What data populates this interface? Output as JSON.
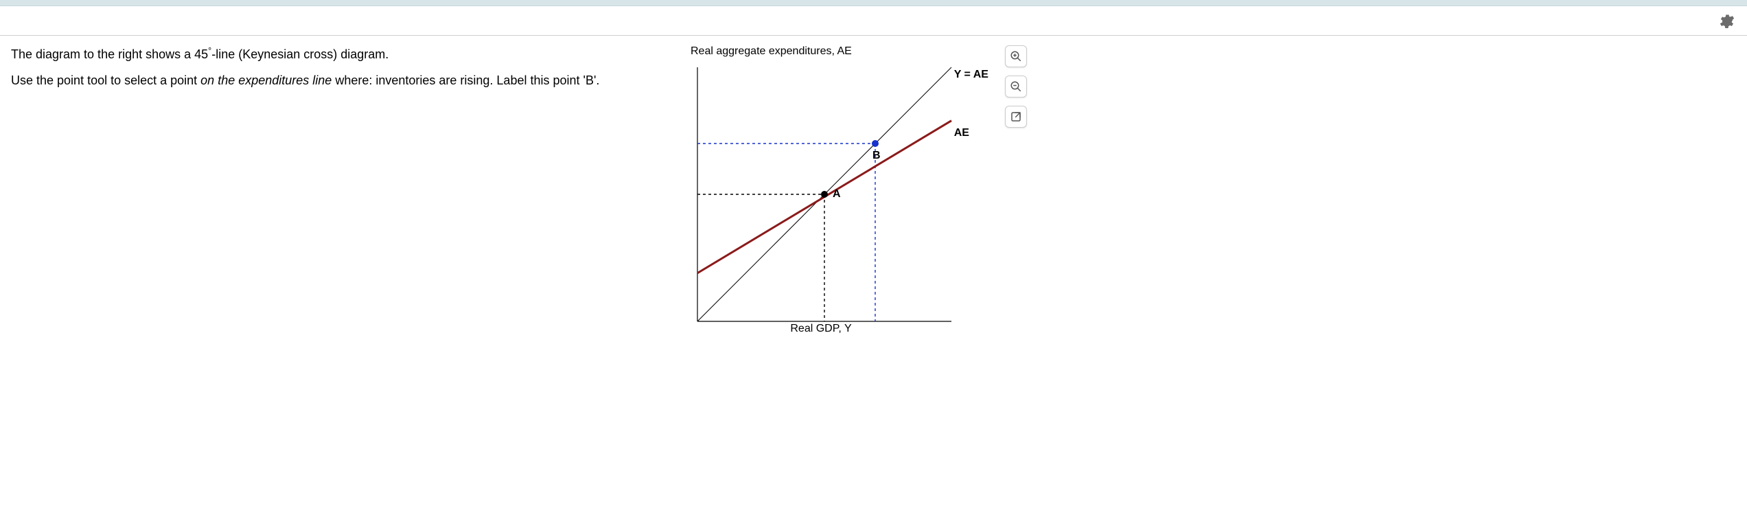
{
  "question": {
    "intro_html": "The diagram to the right shows a 45<span class='sup'>°</span>-line (Keynesian cross) diagram.",
    "task_html": "Use the point tool to select a point <span class='italic'>on the expenditures line</span> where: inventories are rising. Label this point 'B'."
  },
  "chart_data": {
    "type": "line",
    "title": "Real aggregate expenditures, AE",
    "xlabel": "Real GDP, Y",
    "ylabel": "",
    "xlim": [
      0,
      10
    ],
    "ylim": [
      0,
      10
    ],
    "series": [
      {
        "name": "Y = AE",
        "x": [
          0,
          10
        ],
        "y": [
          0,
          10
        ],
        "color": "#000000",
        "width": 1
      },
      {
        "name": "AE",
        "x": [
          0,
          10
        ],
        "y": [
          1.9,
          7.9
        ],
        "color": "#8b1a1a",
        "width": 3
      }
    ],
    "points": [
      {
        "name": "A",
        "x": 5.0,
        "y": 5.0,
        "color": "#000000",
        "guides": {
          "to_x_axis": true,
          "to_y_axis": true,
          "color": "#000000"
        },
        "label_offset": {
          "dx": 12,
          "dy": 4
        }
      },
      {
        "name": "B",
        "x": 7.0,
        "y": 7.0,
        "color": "#1733cc",
        "guides": {
          "to_x_axis": true,
          "to_y_axis": true,
          "color": "#1733cc"
        },
        "label_offset": {
          "dx": -4,
          "dy": 22
        }
      }
    ],
    "line_labels": [
      {
        "text": "Y = AE",
        "x": 10.1,
        "y": 9.6
      },
      {
        "text": "AE",
        "x": 10.1,
        "y": 7.3
      }
    ]
  },
  "tools": {
    "zoom_in": "Zoom in",
    "zoom_out": "Zoom out",
    "popout": "Open in new window",
    "settings": "Settings"
  }
}
